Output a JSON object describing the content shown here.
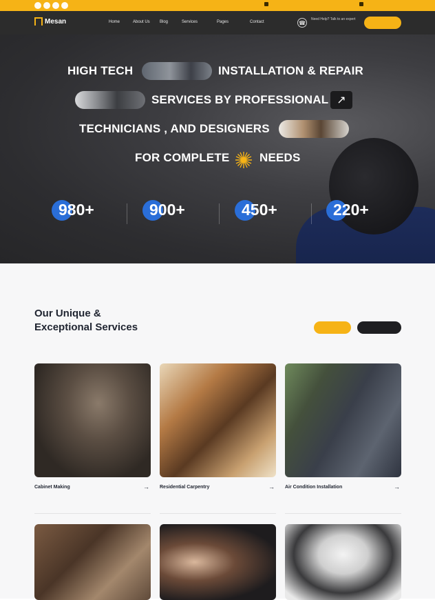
{
  "topbar": {
    "social_icons": [
      "facebook-icon",
      "twitter-icon",
      "instagram-icon",
      "linkedin-icon"
    ],
    "location": "",
    "email": ""
  },
  "header": {
    "logo_text": "Mesan",
    "menu": [
      "Home",
      "About Us",
      "Blog",
      "Services",
      "Pages",
      "Contact"
    ],
    "phone_label": "Need Help? Talk to an expert",
    "phone_number": "",
    "cta_label": ""
  },
  "hero": {
    "line1_left": "HIGH TECH",
    "line1_right": "INSTALLATION & REPAIR",
    "line2": "SERVICES BY PROFESSIONAL",
    "line3": "TECHNICIANS ,  AND DESIGNERS",
    "line4_left": "FOR COMPLETE",
    "line4_right": "NEEDS",
    "arrow_icon": "arrow-up-right-icon",
    "stats": [
      {
        "value": "980+",
        "label": ""
      },
      {
        "value": "900+",
        "label": ""
      },
      {
        "value": "450+",
        "label": ""
      },
      {
        "value": "220+",
        "label": ""
      }
    ]
  },
  "services": {
    "eyebrow": "",
    "title_line1": "Our Unique &",
    "title_line2": "Exceptional Services",
    "btn_primary": "",
    "btn_secondary": "",
    "cards": [
      {
        "title": "Cabinet Making",
        "desc": ""
      },
      {
        "title": "Residential Carpentry",
        "desc": ""
      },
      {
        "title": "Air Condition Installation",
        "desc": ""
      }
    ]
  },
  "colors": {
    "accent": "#f6b316",
    "dark": "#1f1f22",
    "stat_circle": "#2a6ed8"
  }
}
